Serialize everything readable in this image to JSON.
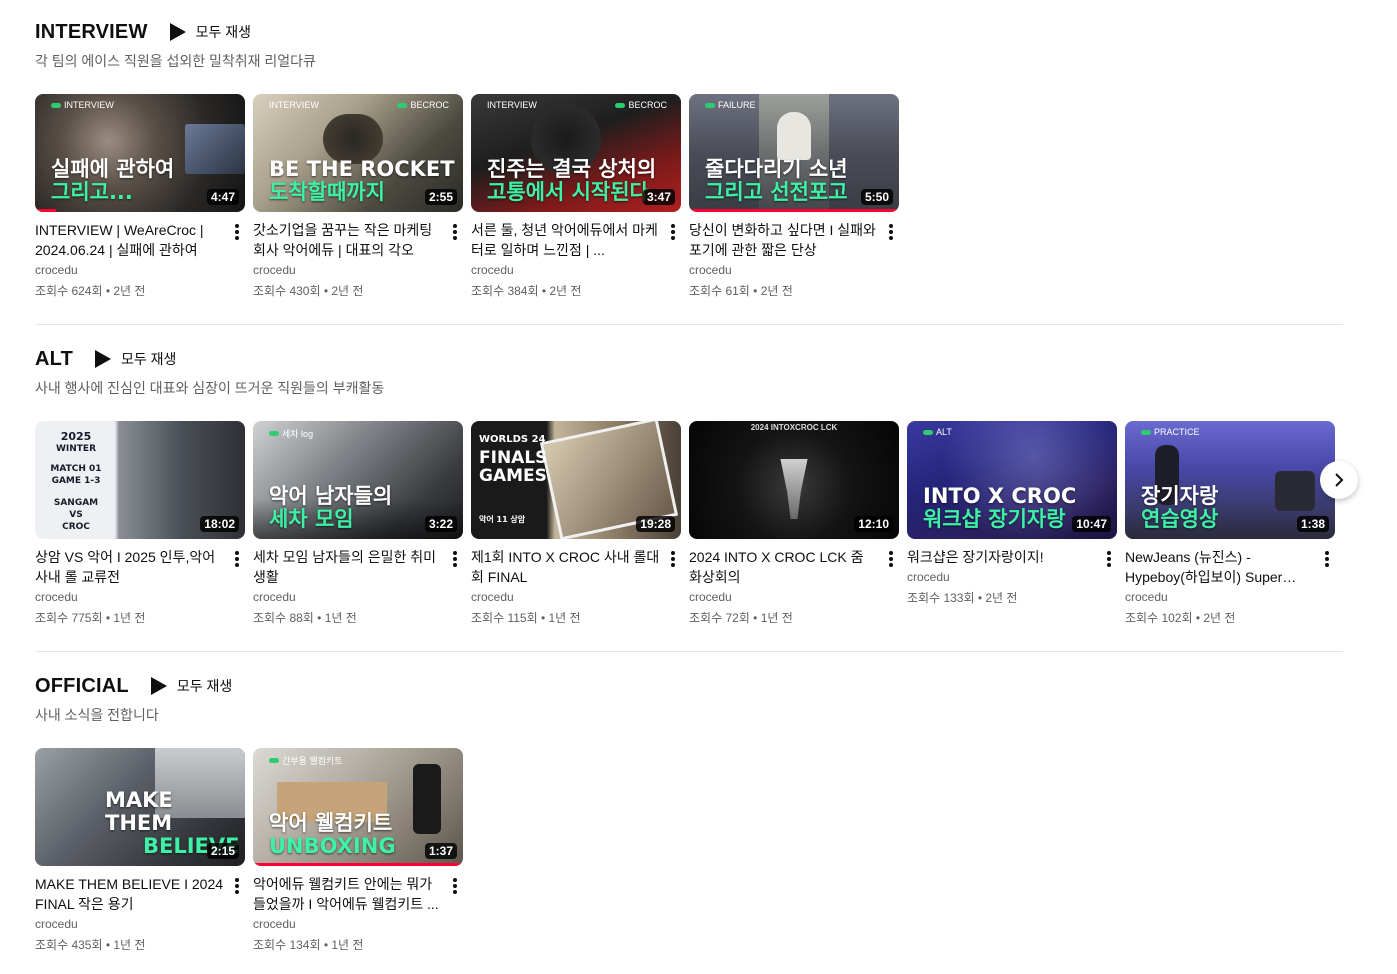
{
  "colors": {
    "accent_green": "#3df2a6",
    "progress_red": "#ff0033",
    "muted": "#606060"
  },
  "shelves": [
    {
      "title": "INTERVIEW",
      "play_all": "모두 재생",
      "description": "각 팀의 에이스 직원을 섭외한 밀착취재 리얼다큐",
      "videos": [
        {
          "tag": "INTERVIEW",
          "tag_right": "",
          "line1": "실패에 관하여",
          "line2": "그리고...",
          "duration": "4:47",
          "progress": 0.1,
          "title": "INTERVIEW | WeAreCroc | 2024.06.24 | 실패에 관하여",
          "channel": "crocedu",
          "stats": "조회수 624회 • 2년 전"
        },
        {
          "tag": "INTERVIEW",
          "tag_right": "BECROC",
          "line1": "BE THE ROCKET",
          "line2": "도착할때까지",
          "duration": "2:55",
          "progress": 0,
          "title": "갓소기업을 꿈꾸는 작은 마케팅 회사 악어에듀 | 대표의 각오",
          "channel": "crocedu",
          "stats": "조회수 430회 • 2년 전"
        },
        {
          "tag": "INTERVIEW",
          "tag_right": "BECROC",
          "line1": "진주는 결국 상처의",
          "line2": "고통에서 시작된다",
          "duration": "3:47",
          "progress": 0,
          "title": "서른 둘, 청년 악어에듀에서 마케터로 일하며 느낀점 | ...",
          "channel": "crocedu",
          "stats": "조회수 384회 • 2년 전"
        },
        {
          "tag": "FAILURE",
          "tag_right": "",
          "line1": "줄다다리기 소년",
          "line2": "그리고 선전포고",
          "duration": "5:50",
          "progress": 1.0,
          "title": "당신이 변화하고 싶다면 I 실패와 포기에 관한 짧은 단상",
          "channel": "crocedu",
          "stats": "조회수 61회 • 2년 전"
        }
      ]
    },
    {
      "title": "ALT",
      "play_all": "모두 재생",
      "description": "사내 행사에 진심인 대표와 심장이 뜨거운 직원들의 부캐활동",
      "videos": [
        {
          "tag": "",
          "tag_right": "",
          "line1": "",
          "line2": "",
          "side_text": [
            "2025",
            "WINTER",
            "MATCH 01",
            "GAME 1-3",
            "SANGAM",
            "VS",
            "CROC"
          ],
          "duration": "18:02",
          "progress": 0,
          "title": "상암 VS 악어 I 2025 인투,악어 사내 롤 교류전",
          "channel": "crocedu",
          "stats": "조회수 775회 • 1년 전"
        },
        {
          "tag": "세차 log",
          "tag_right": "",
          "line1": "악어 남자들의",
          "line2": "세차 모임",
          "duration": "3:22",
          "progress": 0,
          "title": "세차 모임 남자들의 은밀한 취미생활",
          "channel": "crocedu",
          "stats": "조회수 88회 • 1년 전"
        },
        {
          "tag": "",
          "tag_right": "",
          "line1": "",
          "line2": "",
          "side_text": [
            "WORLDS 24",
            "FINALS",
            "GAMES",
            "악어 11 상암"
          ],
          "duration": "19:28",
          "progress": 0,
          "title": "제1회 INTO X CROC 사내 롤대회 FINAL",
          "channel": "crocedu",
          "stats": "조회수 115회 • 1년 전"
        },
        {
          "tag": "",
          "tag_right": "",
          "line1": "",
          "line2": "",
          "top_text": "2024 INTOXCROC LCK",
          "duration": "12:10",
          "progress": 0,
          "title": "2024 INTO X CROC LCK 줌 화상회의",
          "channel": "crocedu",
          "stats": "조회수 72회 • 1년 전"
        },
        {
          "tag": "ALT",
          "tag_right": "",
          "line1": "INTO X CROC",
          "line2": "워크샵 장기자랑",
          "duration": "10:47",
          "progress": 0,
          "title": "워크샵은 장기자랑이지!",
          "channel": "crocedu",
          "stats": "조회수 133회 • 2년 전"
        },
        {
          "tag": "PRACTICE",
          "tag_right": "",
          "line1": "장기자랑",
          "line2": "연습영상",
          "duration": "1:38",
          "progress": 0,
          "title": "NewJeans (뉴진스) - Hypeboy(하입보이) Super Sh...",
          "channel": "crocedu",
          "stats": "조회수 102회 • 2년 전"
        }
      ]
    },
    {
      "title": "OFFICIAL",
      "play_all": "모두 재생",
      "description": "사내 소식을 전합니다",
      "videos": [
        {
          "tag": "",
          "tag_right": "",
          "line1": "MAKE THEM",
          "line2": "BELIEVE",
          "duration": "2:15",
          "progress": 0,
          "title": "MAKE THEM BELIEVE I 2024 FINAL 작은 용기",
          "channel": "crocedu",
          "stats": "조회수 435회 • 1년 전"
        },
        {
          "tag": "간부용 웰컴키트",
          "tag_right": "",
          "line1": "악어 웰컴키트",
          "line2": "UNBOXING",
          "duration": "1:37",
          "progress": 1.0,
          "title": "악어에듀 웰컴키트 안에는 뭐가 들었을까 I 악어에듀 웰컴키트 ...",
          "channel": "crocedu",
          "stats": "조회수 134회 • 1년 전"
        }
      ]
    }
  ]
}
